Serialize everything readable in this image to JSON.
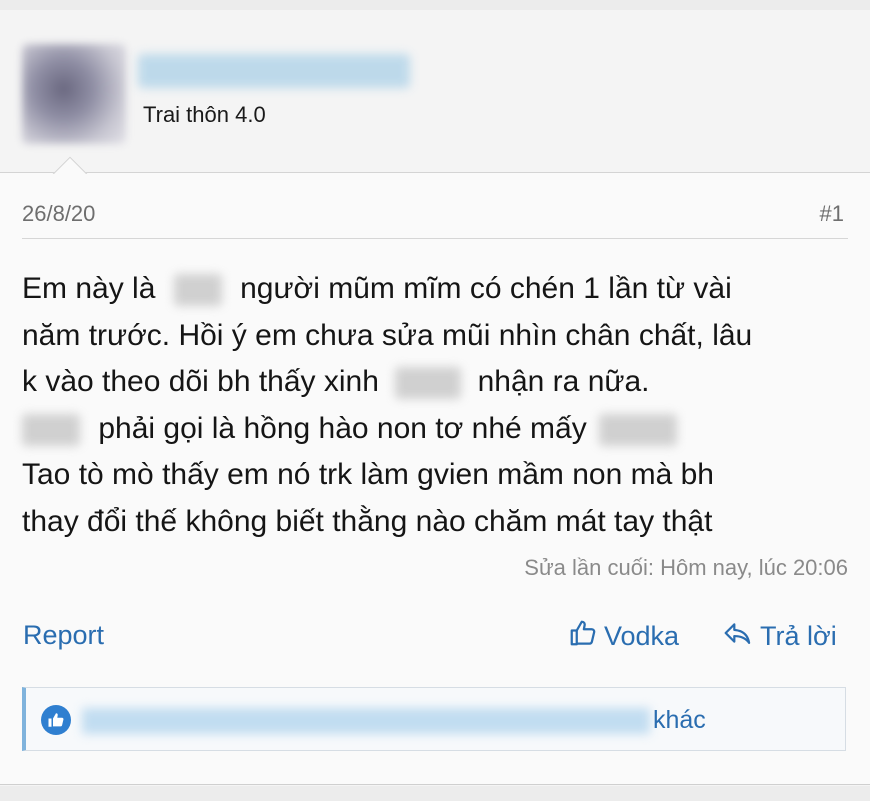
{
  "user": {
    "title": "Trai thôn 4.0"
  },
  "post": {
    "date": "26/8/20",
    "number": "#1",
    "lines": {
      "l1a": "Em này là",
      "l1b": "người mũm mĩm có chén 1 lần từ vài",
      "l2": "năm trước. Hồi ý em chưa sửa mũi nhìn chân chất, lâu",
      "l3a": "k vào theo dõi bh thấy xinh",
      "l3b": "nhận ra nữa.",
      "l4a": "phải gọi là hồng hào non tơ nhé mấy",
      "l5": "Tao tò mò thấy em nó trk làm gvien mầm non mà bh",
      "l6": "thay đổi thế không biết thằng nào chăm mát tay thật"
    },
    "edited": "Sửa lần cuối: Hôm nay, lúc 20:06"
  },
  "actions": {
    "report": "Report",
    "like": "Vodka",
    "reply": "Trả lời"
  },
  "likes": {
    "suffix": "khác"
  },
  "colors": {
    "link": "#2a6db0",
    "muted": "#8a8a8a",
    "like_badge": "#2f7fd0"
  }
}
